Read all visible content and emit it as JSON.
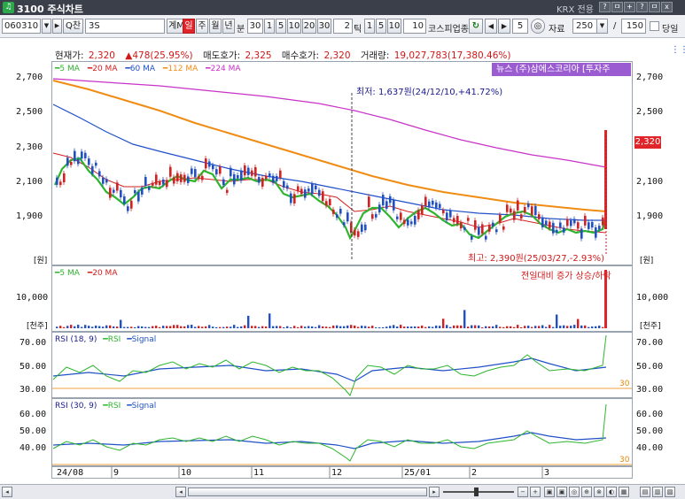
{
  "window": {
    "title": "3100 주식차트",
    "tag": "KRX 전용",
    "buttons": [
      "?",
      "ㅁ",
      "+",
      "?",
      "ㅁ",
      "x"
    ]
  },
  "toolbar": {
    "code": "060310",
    "find_label": "Q찬",
    "name": "3S",
    "group_label": "계M",
    "periods": [
      "일",
      "주",
      "월",
      "년"
    ],
    "minute_label": "분",
    "minute_value": "30",
    "tick_values": [
      "1",
      "5",
      "10",
      "20",
      "30"
    ],
    "tick_input": "2",
    "tick_label": "틱",
    "tick_values2": [
      "1",
      "5",
      "10"
    ],
    "tick_input2": "10",
    "market_label": "코스피업종",
    "step_value": "5",
    "data_label": "자료",
    "data_count": "250",
    "slash": "/",
    "total": "150",
    "today_label": "당일"
  },
  "info": {
    "current_label": "현재가:",
    "current_value": "2,320",
    "change": "▲478(25.95%)",
    "ask_label": "매도호가:",
    "ask_value": "2,325",
    "bid_label": "매수호가:",
    "bid_value": "2,320",
    "volume_label": "거래량:",
    "volume_value": "19,027,783(17,380.46%)"
  },
  "price_panel": {
    "legend": [
      {
        "label": "5 MA",
        "color": "#2db52d"
      },
      {
        "label": "20 MA",
        "color": "#d42020"
      },
      {
        "label": "60 MA",
        "color": "#2050c8"
      },
      {
        "label": "112 MA",
        "color": "#f08c14"
      },
      {
        "label": "224 MA",
        "color": "#c832c8"
      }
    ],
    "news": "뉴스 (주)삼에스코리아 [투자주",
    "y_labels": [
      "2,700",
      "2,500",
      "2,300",
      "2,100",
      "1,900"
    ],
    "unit": "[원]",
    "low_note": "최저: 1,637원(24/12/10,+41.72%)",
    "high_note": "최고: 2,390원(25/03/27,-2.93%)",
    "price_tag": "2,320"
  },
  "volume_panel": {
    "legend": [
      {
        "label": "5 MA",
        "color": "#2db52d"
      },
      {
        "label": "20 MA",
        "color": "#d42020"
      }
    ],
    "note": "전일대비 증가 상승/하락",
    "y_label": "10,000",
    "unit": "[천주]"
  },
  "rsi1_panel": {
    "title": "RSI (18, 9)",
    "rsi_label": "RSI",
    "signal_label": "Signal",
    "y_labels": [
      "70.00",
      "50.00",
      "30.00"
    ],
    "threshold": "30"
  },
  "rsi2_panel": {
    "title": "RSI (30, 9)",
    "rsi_label": "RSI",
    "signal_label": "Signal",
    "y_labels": [
      "60.00",
      "50.00",
      "40.00"
    ],
    "threshold": "30"
  },
  "x_axis": [
    "24/08",
    "9",
    "10",
    "11",
    "12",
    "25/01",
    "2",
    "3"
  ],
  "units": {
    "right_price": "[원]",
    "right_vol": "[천주]"
  }
}
